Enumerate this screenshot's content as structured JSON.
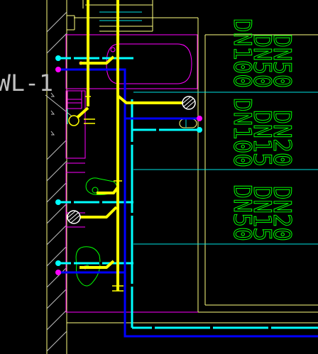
{
  "drawing": {
    "background": "#000000",
    "riser_label": "WL-1",
    "pipe_labels": {
      "group_top": [
        "DN100",
        "DN50",
        "DN50"
      ],
      "group_mid": [
        "DN100",
        "DN15",
        "DN20"
      ],
      "group_bot": [
        "DN50",
        "DN15",
        "DN20"
      ]
    },
    "layers": {
      "drain_pipe": {
        "color": "#ffff00",
        "description_icon": "drain-pipe-line"
      },
      "cold_water": {
        "color": "#00ffff",
        "description_icon": "cold-water-line"
      },
      "hot_water": {
        "color": "#0000ff",
        "description_icon": "hot-water-line"
      },
      "fixtures": {
        "color": "#ff00ff",
        "description_icon": "fixture-outline"
      },
      "walls": {
        "color": "#ffff80",
        "description_icon": "wall-outline"
      },
      "dims": {
        "color": "#00e5e5",
        "description_icon": "dimension-line"
      },
      "labels": {
        "color": "#00ff00",
        "description_icon": "text-label"
      },
      "structure": {
        "color": "#c0c0c0",
        "description_icon": "wall-hatch"
      }
    }
  }
}
